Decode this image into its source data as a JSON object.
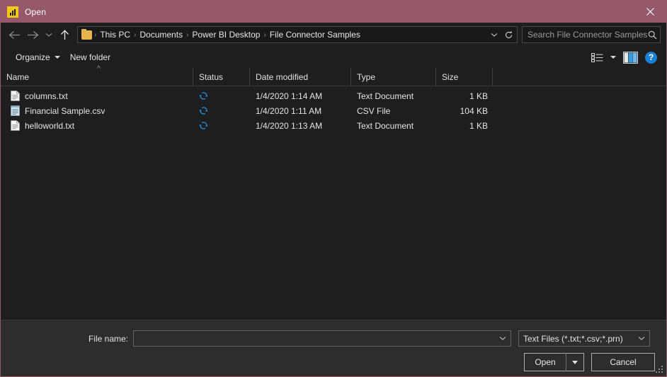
{
  "window": {
    "title": "Open",
    "app_icon": "powerbi-chart-icon",
    "close_label": "Close",
    "titlebar_color": "#96596b",
    "body_color": "#1e1e1e",
    "accent_color": "#1f8ad8"
  },
  "nav": {
    "back_label": "Back",
    "forward_label": "Forward",
    "recent_label": "Recent locations",
    "up_label": "Up to Power BI Desktop",
    "breadcrumbs": [
      "This PC",
      "Documents",
      "Power BI Desktop",
      "File Connector Samples"
    ],
    "separator": "›",
    "dropdown_label": "Previous locations",
    "refresh_label": "Refresh"
  },
  "search": {
    "placeholder": "Search File Connector Samples",
    "value": "",
    "icon": "search-icon"
  },
  "toolbar": {
    "organize_label": "Organize",
    "new_folder_label": "New folder",
    "view_label": "Change your view",
    "pane_label": "Show the preview pane",
    "help_label": "?"
  },
  "columns": [
    {
      "key": "name",
      "label": "Name",
      "sorted": "asc",
      "sort_glyph": "^"
    },
    {
      "key": "status",
      "label": "Status"
    },
    {
      "key": "date",
      "label": "Date modified"
    },
    {
      "key": "type",
      "label": "Type"
    },
    {
      "key": "size",
      "label": "Size"
    }
  ],
  "files": [
    {
      "name": "columns.txt",
      "icon": "text-document-icon",
      "status_icon": "sync-pending-icon",
      "date": "1/4/2020 1:14 AM",
      "type": "Text Document",
      "size": "1 KB"
    },
    {
      "name": "Financial Sample.csv",
      "icon": "csv-file-icon",
      "status_icon": "sync-pending-icon",
      "date": "1/4/2020 1:11 AM",
      "type": "CSV File",
      "size": "104 KB"
    },
    {
      "name": "helloworld.txt",
      "icon": "text-document-icon",
      "status_icon": "sync-pending-icon",
      "date": "1/4/2020 1:13 AM",
      "type": "Text Document",
      "size": "1 KB"
    }
  ],
  "footer": {
    "filename_label": "File name:",
    "filename_value": "",
    "filename_placeholder": "",
    "filetype_value": "Text Files (*.txt;*.csv;*.prn)",
    "open_label": "Open",
    "open_dropdown_label": "Open options",
    "cancel_label": "Cancel",
    "resize_grip_label": "Resize"
  }
}
